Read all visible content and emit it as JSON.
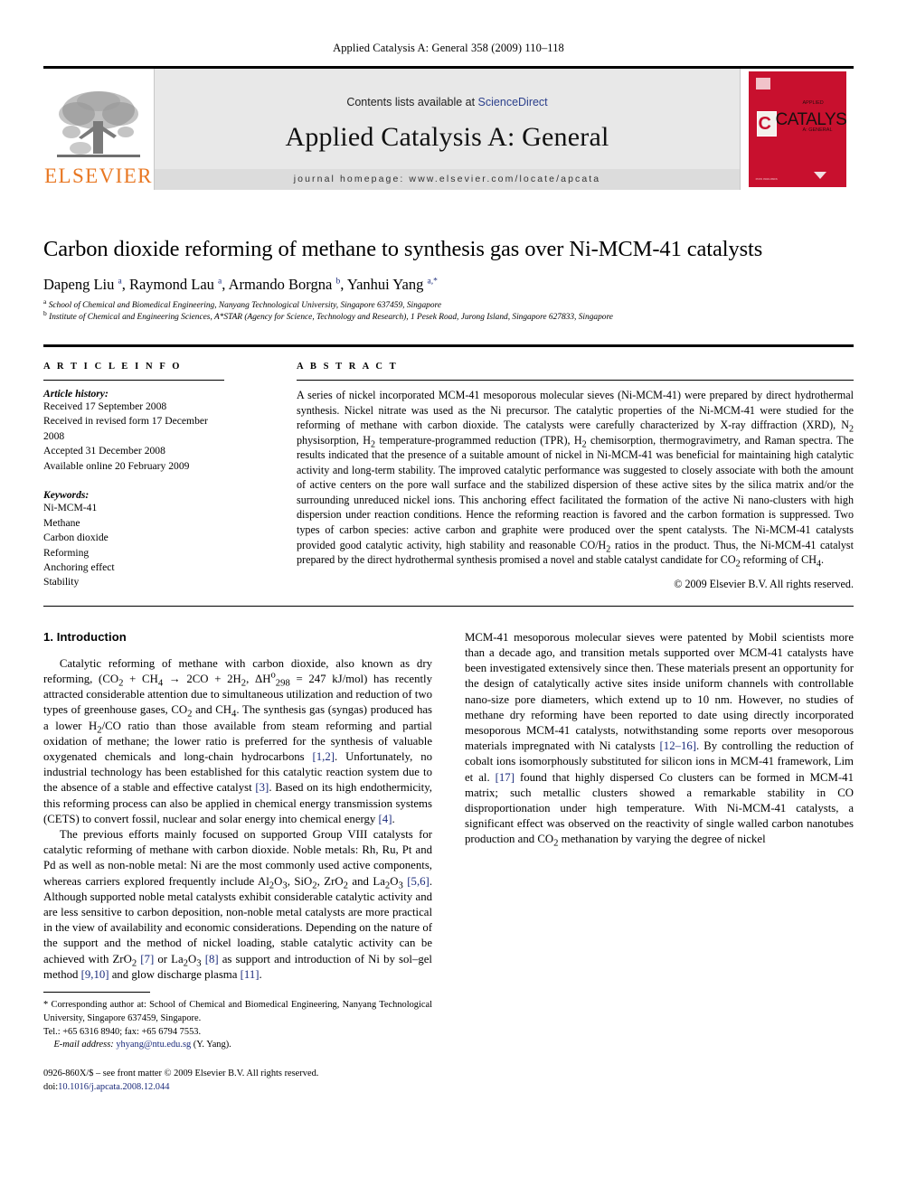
{
  "running_head": "Applied Catalysis A: General 358 (2009) 110–118",
  "masthead": {
    "contents_prefix": "Contents lists available at ",
    "sciencedirect": "ScienceDirect",
    "journal_title": "Applied Catalysis A: General",
    "homepage": "journal homepage: www.elsevier.com/locate/apcata",
    "publisher_logo_text": "ELSEVIER",
    "cover": {
      "c_letter": "C",
      "main_word": "CATALYSIS",
      "applied": "APPLIED",
      "a_general": "A: GENERAL",
      "footer_note": "Available online at\nwww.sciencedirect.com",
      "bottom_left": "ISSN 0926-860X"
    },
    "accent_orange": "#E87722",
    "cover_red": "#c8102e",
    "link_blue": "#2b3f8c"
  },
  "article": {
    "title": "Carbon dioxide reforming of methane to synthesis gas over Ni-MCM-41 catalysts",
    "authors_html": "Dapeng Liu <sup>a</sup>, Raymond Lau <sup>a</sup>, Armando Borgna <sup>b</sup>, Yanhui Yang <sup>a,</sup><sup>*</sup>",
    "affiliation_a": "School of Chemical and Biomedical Engineering, Nanyang Technological University, Singapore 637459, Singapore",
    "affiliation_b": "Institute of Chemical and Engineering Sciences, A*STAR (Agency for Science, Technology and Research), 1 Pesek Road, Jurong Island, Singapore 627833, Singapore"
  },
  "article_info": {
    "label": "A R T I C L E   I N F O",
    "history_heading": "Article history:",
    "history": [
      "Received 17 September 2008",
      "Received in revised form 17 December 2008",
      "Accepted 31 December 2008",
      "Available online 20 February 2009"
    ],
    "keywords_heading": "Keywords:",
    "keywords": [
      "Ni-MCM-41",
      "Methane",
      "Carbon dioxide",
      "Reforming",
      "Anchoring effect",
      "Stability"
    ]
  },
  "abstract": {
    "label": "A B S T R A C T",
    "text_p1": "A series of nickel incorporated MCM-41 mesoporous molecular sieves (Ni-MCM-41) were prepared by direct hydrothermal synthesis. Nickel nitrate was used as the Ni precursor. The catalytic properties of the Ni-MCM-41 were studied for the reforming of methane with carbon dioxide. The catalysts were carefully characterized by X-ray diffraction (XRD), N",
    "text_p2": " physisorption, H",
    "text_p3": " temperature-programmed reduction (TPR), H",
    "text_p4": " chemisorption, thermogravimetry, and Raman spectra. The results indicated that the presence of a suitable amount of nickel in Ni-MCM-41 was beneficial for maintaining high catalytic activity and long-term stability. The improved catalytic performance was suggested to closely associate with both the amount of active centers on the pore wall surface and the stabilized dispersion of these active sites by the silica matrix and/or the surrounding unreduced nickel ions. This anchoring effect facilitated the formation of the active Ni nano-clusters with high dispersion under reaction conditions. Hence the reforming reaction is favored and the carbon formation is suppressed. Two types of carbon species: active carbon and graphite were produced over the spent catalysts. The Ni-MCM-41 catalysts provided good catalytic activity, high stability and reasonable CO/H",
    "text_p5": " ratios in the product. Thus, the Ni-MCM-41 catalyst prepared by the direct hydrothermal synthesis promised a novel and stable catalyst candidate for CO",
    "text_p6": " reforming of CH",
    "text_p7": ".",
    "sub_2a": "2",
    "sub_2b": "2",
    "sub_2c": "2",
    "sub_2d": "2",
    "sub_2e": "2",
    "sub_4": "4",
    "copyright": "© 2009 Elsevier B.V. All rights reserved."
  },
  "introduction": {
    "heading": "1. Introduction",
    "p1_a": "Catalytic reforming of methane with carbon dioxide, also known as dry reforming, (CO",
    "p1_sub1": "2",
    "p1_b": " + CH",
    "p1_sub2": "4",
    "p1_c": " → 2CO + 2H",
    "p1_sub3": "2",
    "p1_d": ", ΔH",
    "p1_sup_circ": "o",
    "p1_sub298": "298",
    "p1_e": " = 247 kJ/mol) has recently attracted considerable attention due to simultaneous utilization and reduction of two types of greenhouse gases, CO",
    "p1_sub4": "2",
    "p1_f": " and CH",
    "p1_sub5": "4",
    "p1_g": ". The synthesis gas (syngas) produced has a lower H",
    "p1_sub6": "2",
    "p1_h": "/CO ratio than those available from steam reforming and partial oxidation of methane; the lower ratio is preferred for the synthesis of valuable oxygenated chemicals and long-chain hydrocarbons ",
    "p1_ref12": "[1,2]",
    "p1_i": ". Unfortunately, no industrial technology has been established for this catalytic reaction system due to the absence of a stable and effective catalyst ",
    "p1_ref3": "[3]",
    "p1_j": ". Based on its high endothermicity, this reforming process can also be applied in chemical energy transmission systems (CETS) to convert fossil, nuclear and solar energy into chemical energy ",
    "p1_ref4": "[4]",
    "p1_k": ".",
    "p2_a": "The previous efforts mainly focused on supported Group VIII catalysts for catalytic reforming of methane with carbon dioxide. Noble metals: Rh, Ru, Pt and Pd as well as non-noble metal: Ni are the most commonly used active components, whereas carriers explored frequently include Al",
    "p2_sub1": "2",
    "p2_b": "O",
    "p2_sub2": "3",
    "p2_c": ", SiO",
    "p2_sub3": "2",
    "p2_d": ", ZrO",
    "p2_sub4": "2",
    "p2_e": " and La",
    "p2_sub5": "2",
    "p2_f": "O",
    "p2_sub6": "3",
    "p2_g": " ",
    "p2_ref56": "[5,6]",
    "p2_h": ". Although supported noble metal catalysts exhibit considerable catalytic activity and are less sensitive to carbon deposition, non-noble metal catalysts are more practical in the view of availability and economic considerations. Depending on the nature of the support and the method of nickel loading, stable catalytic activity can be achieved with ZrO",
    "p2_sub7": "2",
    "p2_i": " ",
    "p2_ref7": "[7]",
    "p2_j": " or La",
    "p2_sub8": "2",
    "p2_k": "O",
    "p2_sub9": "3",
    "p2_l": " ",
    "p2_ref8": "[8]",
    "p2_m": " as support and introduction of Ni by sol–gel method ",
    "p2_ref910": "[9,10]",
    "p2_n": " and glow discharge plasma ",
    "p2_ref11": "[11]",
    "p2_o": ".",
    "p3_a": "MCM-41 mesoporous molecular sieves were patented by Mobil scientists more than a decade ago, and transition metals supported over MCM-41 catalysts have been investigated extensively since then. These materials present an opportunity for the design of catalytically active sites inside uniform channels with controllable nano-size pore diameters, which extend up to 10 nm. However, no studies of methane dry reforming have been reported to date using directly incorporated mesoporous MCM-41 catalysts, notwithstanding some reports over mesoporous materials impregnated with Ni catalysts ",
    "p3_ref1216": "[12–16]",
    "p3_b": ". By controlling the reduction of cobalt ions isomorphously substituted for silicon ions in MCM-41 framework, Lim et al. ",
    "p3_ref17": "[17]",
    "p3_c": " found that highly dispersed Co clusters can be formed in MCM-41 matrix; such metallic clusters showed a remarkable stability in CO disproportionation under high temperature. With Ni-MCM-41 catalysts, a significant effect was observed on the reactivity of single walled carbon nanotubes production and CO",
    "p3_sub1": "2",
    "p3_d": " methanation by varying the degree of nickel"
  },
  "footnote": {
    "star": "*",
    "corresponding": " Corresponding author at: School of Chemical and Biomedical Engineering, Nanyang Technological University, Singapore 637459, Singapore.",
    "tel": "Tel.: +65 6316 8940; fax: +65 6794 7553.",
    "email_label": "E-mail address:",
    "email": "yhyang@ntu.edu.sg",
    "email_suffix": " (Y. Yang)."
  },
  "imprint": {
    "line1": "0926-860X/$ – see front matter © 2009 Elsevier B.V. All rights reserved.",
    "doi_label": "doi:",
    "doi_value": "10.1016/j.apcata.2008.12.044"
  }
}
